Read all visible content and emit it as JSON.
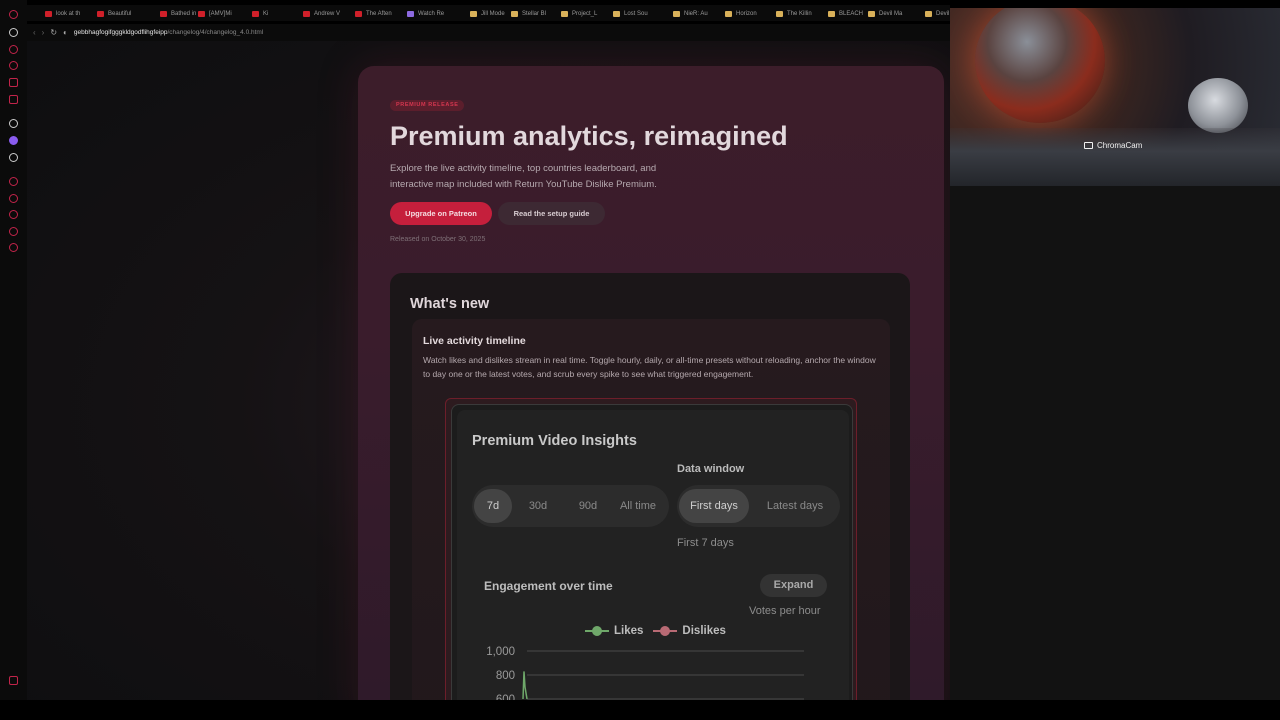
{
  "browser": {
    "tabs": [
      {
        "label": "look at th",
        "fav": "red"
      },
      {
        "label": "Beautiful",
        "fav": "red"
      },
      {
        "label": "Bathed in",
        "fav": "red"
      },
      {
        "label": "[AMV]Mi",
        "fav": "red"
      },
      {
        "label": "Ki",
        "fav": "red"
      },
      {
        "label": "Andrew V",
        "fav": "red"
      },
      {
        "label": "The Aften",
        "fav": "red"
      },
      {
        "label": "Watch Re",
        "fav": "pur"
      },
      {
        "label": "Jill Mode",
        "fav": "yel"
      },
      {
        "label": "Stellar Bl",
        "fav": "yel"
      },
      {
        "label": "Project_L",
        "fav": "yel"
      },
      {
        "label": "Lost Sou",
        "fav": "yel"
      },
      {
        "label": "NieR: Au",
        "fav": "yel"
      },
      {
        "label": "Horizon",
        "fav": "yel"
      },
      {
        "label": "The Killin",
        "fav": "yel"
      },
      {
        "label": "BLEACH",
        "fav": "yel"
      },
      {
        "label": "Devil Ma",
        "fav": "yel"
      },
      {
        "label": "Devil",
        "fav": "yel"
      }
    ],
    "url_host": "gebbhagfogifgggkldgodflihgfeipp",
    "url_path": "/changelog/4/changelog_4.0.html"
  },
  "camera": {
    "label": "ChromaCam"
  },
  "hero": {
    "badge": "PREMIUM RELEASE",
    "title": "Premium analytics, reimagined",
    "description": "Explore the live activity timeline, top countries leaderboard, and interactive map included with Return YouTube Dislike Premium.",
    "primary_button": "Upgrade on Patreon",
    "secondary_button": "Read the setup guide",
    "released": "Released on October 30, 2025"
  },
  "whats_new": {
    "title": "What's new",
    "feature": {
      "title": "Live activity timeline",
      "description": "Watch likes and dislikes stream in real time. Toggle hourly, daily, or all-time presets without reloading, anchor the window to day one or the latest votes, and scrub every spike to see what triggered engagement."
    }
  },
  "insights": {
    "title": "Premium Video Insights",
    "data_window_label": "Data window",
    "ranges": [
      "7d",
      "30d",
      "90d",
      "All time"
    ],
    "active_range": "7d",
    "anchors": [
      "First days",
      "Latest days"
    ],
    "active_anchor": "First days",
    "current_window": "First 7 days",
    "engagement_title": "Engagement over time",
    "expand_label": "Expand",
    "unit_label": "Votes per hour",
    "legend": [
      {
        "name": "Likes",
        "color": "#6fa86a"
      },
      {
        "name": "Dislikes",
        "color": "#b86a74"
      }
    ]
  },
  "chart_data": {
    "type": "line",
    "ylabel": "",
    "yticks": [
      1000,
      800,
      600
    ],
    "ylim": [
      600,
      1000
    ],
    "series": [
      {
        "name": "Likes",
        "color": "#6fa86a",
        "points": [
          [
            0,
            600
          ],
          [
            0.5,
            830
          ],
          [
            1,
            700
          ],
          [
            2,
            600
          ]
        ]
      }
    ]
  }
}
